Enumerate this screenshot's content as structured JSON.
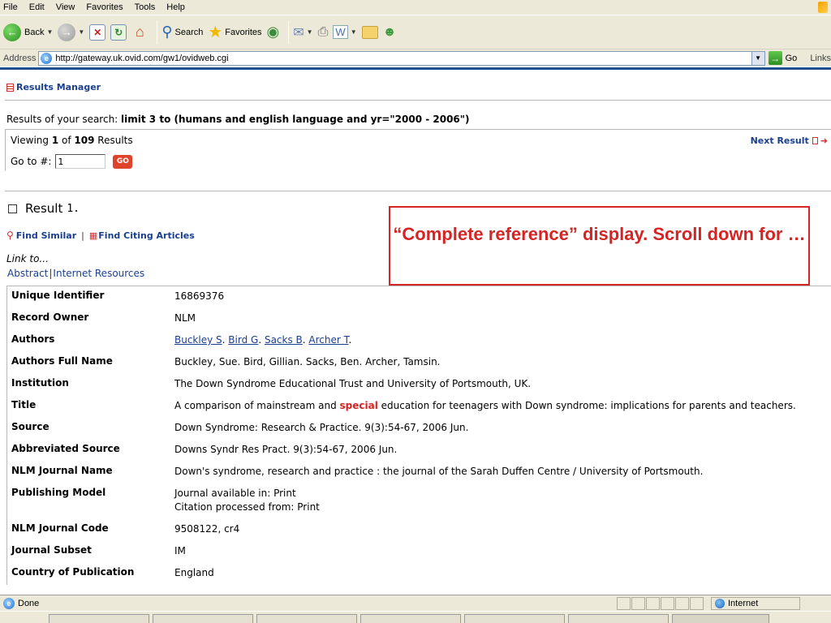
{
  "menu": [
    "File",
    "Edit",
    "View",
    "Favorites",
    "Tools",
    "Help"
  ],
  "toolbar": {
    "back_label": "Back",
    "search_label": "Search",
    "favorites_label": "Favorites"
  },
  "address": {
    "label": "Address",
    "url": "http://gateway.uk.ovid.com/gw1/ovidweb.cgi",
    "go_label": "Go",
    "links_label": "Links"
  },
  "results_manager": "Results Manager",
  "search": {
    "prefix": "Results of your search: ",
    "query": "limit 3 to (humans and english language and yr=\"2000 - 2006\")"
  },
  "viewing": {
    "prefix": "Viewing ",
    "current": "1",
    "of": " of ",
    "total": "109",
    "suffix": " Results",
    "next_result": "Next Result",
    "goto_label": "Go to #:",
    "goto_value": "1",
    "go_button": "GO"
  },
  "result": {
    "label": "Result",
    "number": "1."
  },
  "find": {
    "similar": "Find Similar",
    "separator": "|",
    "citing": "Find Citing Articles"
  },
  "link_to": "Link to...",
  "ext_links": {
    "abstract": "Abstract",
    "sep": "|",
    "internet": "Internet Resources"
  },
  "callout": "“Complete reference” display.  Scroll down for …",
  "record": {
    "unique_identifier": {
      "label": "Unique Identifier",
      "value": "16869376"
    },
    "record_owner": {
      "label": "Record Owner",
      "value": "NLM"
    },
    "authors": {
      "label": "Authors",
      "names": [
        "Buckley S",
        "Bird G",
        "Sacks B",
        "Archer T"
      ]
    },
    "authors_full": {
      "label": "Authors Full Name",
      "value": "Buckley, Sue. Bird, Gillian. Sacks, Ben. Archer, Tamsin."
    },
    "institution": {
      "label": "Institution",
      "value": "The Down Syndrome Educational Trust and University of Portsmouth, UK."
    },
    "title": {
      "label": "Title",
      "before": "A comparison of mainstream and ",
      "highlight": "special",
      "after": " education for teenagers with Down syndrome: implications for parents and teachers."
    },
    "source": {
      "label": "Source",
      "value": "Down Syndrome: Research & Practice. 9(3):54-67, 2006 Jun."
    },
    "abbrev_source": {
      "label": "Abbreviated Source",
      "value": "Downs Syndr Res Pract. 9(3):54-67, 2006 Jun."
    },
    "journal_name": {
      "label": "NLM Journal Name",
      "value": "Down's syndrome, research and practice : the journal of the Sarah Duffen Centre / University of Portsmouth."
    },
    "publishing_model": {
      "label": "Publishing Model",
      "line1": "Journal available in: Print",
      "line2": "Citation processed from: Print"
    },
    "journal_code": {
      "label": "NLM Journal Code",
      "value": "9508122, cr4"
    },
    "journal_subset": {
      "label": "Journal Subset",
      "value": "IM"
    },
    "country": {
      "label": "Country of Publication",
      "value": "England"
    }
  },
  "status": {
    "done": "Done",
    "zone": "Internet"
  }
}
